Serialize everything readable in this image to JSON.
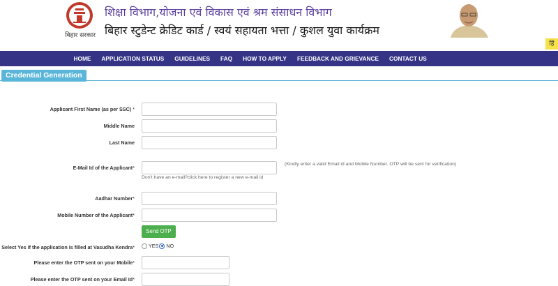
{
  "header": {
    "emblem_caption": "बिहार सरकार",
    "title_line1": "शिक्षा विभाग,योजना एवं विकास एवं श्रम संसाधन विभाग",
    "title_line2": "बिहार स्टुडेन्ट क्रेडिट कार्ड / स्वयं सहायता भत्ता / कुशल युवा कार्यक्रम",
    "lang_toggle": "हिं"
  },
  "nav": {
    "items": [
      "HOME",
      "APPLICATION STATUS",
      "GUIDELINES",
      "FAQ",
      "HOW TO APPLY",
      "FEEDBACK AND GRIEVANCE",
      "CONTACT US"
    ]
  },
  "section": {
    "title": "Credential Generation"
  },
  "form": {
    "first_name_label": "Applicant First Name (as per SSC)",
    "middle_name_label": "Middle Name",
    "last_name_label": "Last Name",
    "email_label": "E-Mail Id of the Applicant",
    "email_hint": "(Kindly enter a valid Email id and Mobile Number. OTP will be sent for verification)",
    "email_help": "Don't have an e-mail?click here to register a new e-mail id",
    "aadhar_label": "Aadhar Number",
    "mobile_label": "Mobile Number of the Applicant",
    "send_otp": "Send OTP",
    "vasudha_label": "Select Yes if the application is filled at Vasudha Kendra",
    "yes": "YES",
    "no": "NO",
    "otp_mobile_label": "Please enter the OTP sent on your Mobile",
    "otp_email_label": "Please enter the OTP sent on your Email Id",
    "required_mark": "*"
  },
  "colors": {
    "nav_bg": "#343386",
    "section_tab": "#5ab6d9",
    "send_otp_bg": "#4cae4c",
    "title1": "#5b3fa0"
  }
}
